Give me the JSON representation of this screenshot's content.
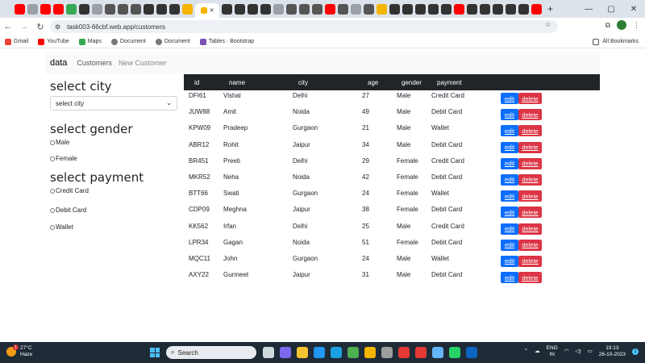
{
  "browser": {
    "url": "task003-66cbf.web.app/customers",
    "window_controls": [
      "—",
      "▢",
      "✕"
    ],
    "new_tab": "+",
    "profile_initial": "",
    "bookmarks": [
      "Gmail",
      "YouTube",
      "Maps",
      "Document",
      "Document",
      "Tables · Bootstrap"
    ],
    "all_bookmarks": "All Bookmarks"
  },
  "navbar": {
    "brand": "data",
    "links": [
      "Customers",
      "New Customer"
    ]
  },
  "filters": {
    "city_title": "select city",
    "city_select": "select city",
    "gender_title": "select gender",
    "gender_options": [
      "Male",
      "Female"
    ],
    "payment_title": "select payment",
    "payment_options": [
      "Credit Card",
      "Debit Card",
      "Wallet"
    ]
  },
  "table": {
    "headers": [
      "id",
      "name",
      "city",
      "age",
      "gender",
      "payment"
    ],
    "rows": [
      {
        "id": "DFI61",
        "name": "Vishal",
        "city": "Delhi",
        "age": "27",
        "gender": "Male",
        "payment": "Credit Card"
      },
      {
        "id": "JUW88",
        "name": "Amit",
        "city": "Noida",
        "age": "49",
        "gender": "Male",
        "payment": "Debit Card"
      },
      {
        "id": "KPW09",
        "name": "Pradeep",
        "city": "Gurgaon",
        "age": "21",
        "gender": "Male",
        "payment": "Wallet"
      },
      {
        "id": "ABR12",
        "name": "Rohit",
        "city": "Jaipur",
        "age": "34",
        "gender": "Male",
        "payment": "Debit Card"
      },
      {
        "id": "BR451",
        "name": "Preeti",
        "city": "Delhi",
        "age": "29",
        "gender": "Female",
        "payment": "Credit Card"
      },
      {
        "id": "MKR52",
        "name": "Neha",
        "city": "Noida",
        "age": "42",
        "gender": "Female",
        "payment": "Debit Card"
      },
      {
        "id": "BTT66",
        "name": "Swati",
        "city": "Gurgaon",
        "age": "24",
        "gender": "Female",
        "payment": "Wallet"
      },
      {
        "id": "CDP09",
        "name": "Meghna",
        "city": "Jaipur",
        "age": "38",
        "gender": "Female",
        "payment": "Debit Card"
      },
      {
        "id": "KK562",
        "name": "Irfan",
        "city": "Delhi",
        "age": "25",
        "gender": "Male",
        "payment": "Credit Card"
      },
      {
        "id": "LPR34",
        "name": "Gagan",
        "city": "Noida",
        "age": "51",
        "gender": "Female",
        "payment": "Debit Card"
      },
      {
        "id": "MQC11",
        "name": "John",
        "city": "Gurgaon",
        "age": "24",
        "gender": "Male",
        "payment": "Wallet"
      },
      {
        "id": "AXY22",
        "name": "Gurmeet",
        "city": "Jaipur",
        "age": "31",
        "gender": "Male",
        "payment": "Debit Card"
      }
    ],
    "edit_label": "edit",
    "delete_label": "delete"
  },
  "taskbar": {
    "temperature": "27°C",
    "weather": "Haze",
    "search_placeholder": "Search",
    "language": "ENG",
    "region": "IN",
    "time": "19:13",
    "date": "26-10-2023",
    "weather_badge": "1",
    "notification_count": "1"
  },
  "colors": {
    "primary": "#0d6efd",
    "danger": "#dc3545",
    "table_header": "#212529",
    "navbar_bg": "#f8f9fa"
  }
}
